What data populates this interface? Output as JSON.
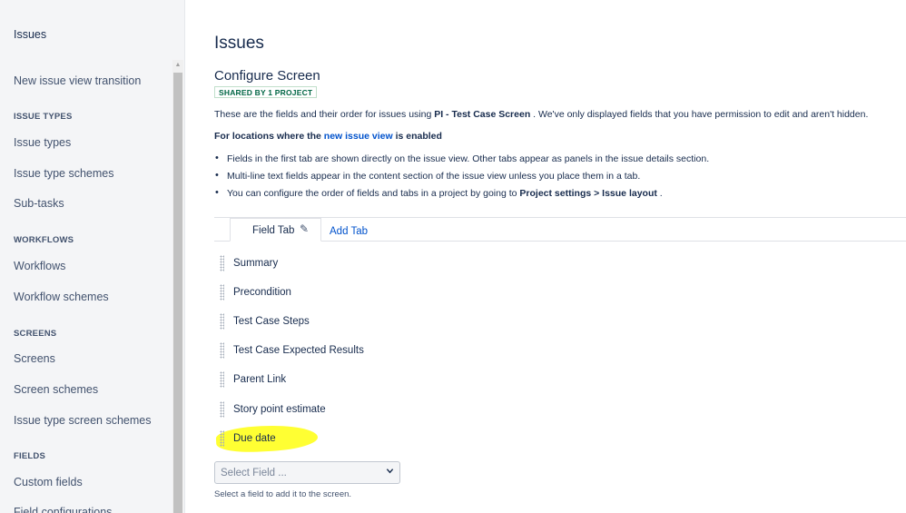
{
  "sidebar": {
    "top_item": "Issues",
    "item_transition": "New issue view transition",
    "section_issue_types": "ISSUE TYPES",
    "item_issue_types": "Issue types",
    "item_issue_type_schemes": "Issue type schemes",
    "item_sub_tasks": "Sub-tasks",
    "section_workflows": "WORKFLOWS",
    "item_workflows": "Workflows",
    "item_workflow_schemes": "Workflow schemes",
    "section_screens": "SCREENS",
    "item_screens": "Screens",
    "item_screen_schemes": "Screen schemes",
    "item_issue_type_screen_schemes": "Issue type screen schemes",
    "section_fields": "FIELDS",
    "item_custom_fields": "Custom fields",
    "item_field_configurations": "Field configurations"
  },
  "main": {
    "title": "Issues",
    "subtitle": "Configure Screen",
    "badge": "SHARED BY 1 PROJECT",
    "desc_prefix": "These are the fields and their order for issues using ",
    "desc_screen": "PI - Test Case Screen",
    "desc_suffix": " . We've only displayed fields that you have permission to edit and aren't hidden.",
    "loc_prefix": "For locations where the ",
    "loc_link": "new issue view",
    "loc_suffix": " is enabled",
    "bullet1": "Fields in the first tab are shown directly on the issue view. Other tabs appear as panels in the issue details section.",
    "bullet2": "Multi-line text fields appear in the content section of the issue view unless you place them in a tab.",
    "bullet3_prefix": "You can configure the order of fields and tabs in a project by going to ",
    "bullet3_b1": "Project settings",
    "bullet3_sep": " > ",
    "bullet3_b2": "Issue layout",
    "bullet3_suffix": " ."
  },
  "tabs": {
    "active": "Field Tab",
    "add": "Add Tab"
  },
  "fields": [
    "Summary",
    "Precondition",
    "Test Case Steps",
    "Test Case Expected Results",
    "Parent Link",
    "Story point estimate",
    "Due date"
  ],
  "select": {
    "placeholder": "Select Field ...",
    "help": "Select a field to add it to the screen."
  },
  "colors": {
    "accent": "#0052cc",
    "highlight": "#ffff33",
    "badge_text": "#006644"
  }
}
